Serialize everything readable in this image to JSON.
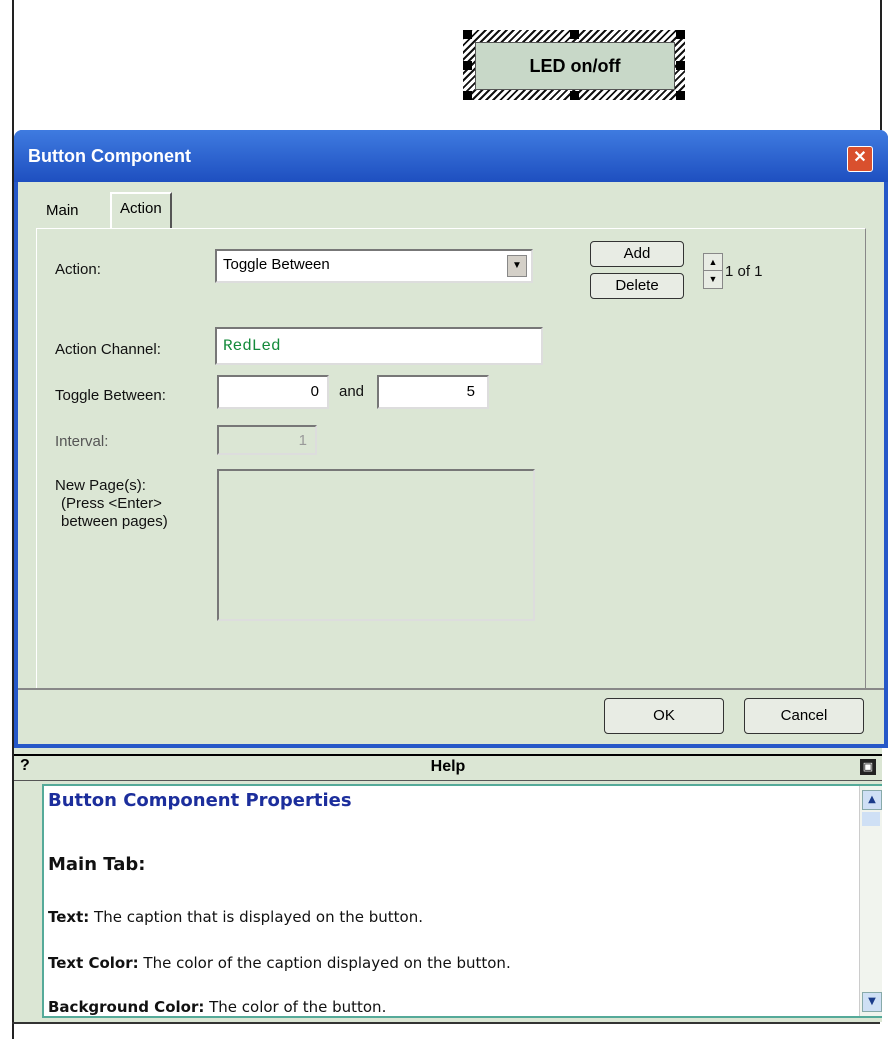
{
  "canvas": {
    "led_button_label": "LED on/off"
  },
  "dialog": {
    "title": "Button Component",
    "close_glyph": "✕",
    "tabs": [
      {
        "label": "Main"
      },
      {
        "label": "Action"
      }
    ],
    "action": {
      "action_label": "Action:",
      "action_value": "Toggle Between",
      "add_label": "Add",
      "delete_label": "Delete",
      "counter": "1 of 1",
      "channel_label": "Action Channel:",
      "channel_value": "RedLed",
      "toggle_label": "Toggle Between:",
      "toggle_from": "0",
      "toggle_and": "and",
      "toggle_to": "5",
      "interval_label": "Interval:",
      "interval_value": "1",
      "newpage_label_1": "New Page(s):",
      "newpage_label_2": "(Press <Enter>",
      "newpage_label_3": "between pages)"
    },
    "ok_label": "OK",
    "cancel_label": "Cancel"
  },
  "help": {
    "question_mark": "?",
    "title": "Help",
    "heading": "Button Component Properties",
    "subheading": "Main Tab:",
    "lines": [
      {
        "term": "Text:",
        "desc": " The caption that is displayed on the button."
      },
      {
        "term": "Text Color:",
        "desc": " The color of the caption displayed on the button."
      },
      {
        "term": "Background Color:",
        "desc": " The color of the button."
      }
    ]
  },
  "icons": {
    "close": "close-icon",
    "dropdown": "chevron-down-icon",
    "spin_up": "caret-up-icon",
    "spin_down": "caret-down-icon",
    "pin": "pin-icon"
  },
  "colors": {
    "titlebar": "#2658c8",
    "dialog_bg": "#dbe6d4",
    "help_heading": "#1c2e9c",
    "channel_text": "#138a3a"
  }
}
